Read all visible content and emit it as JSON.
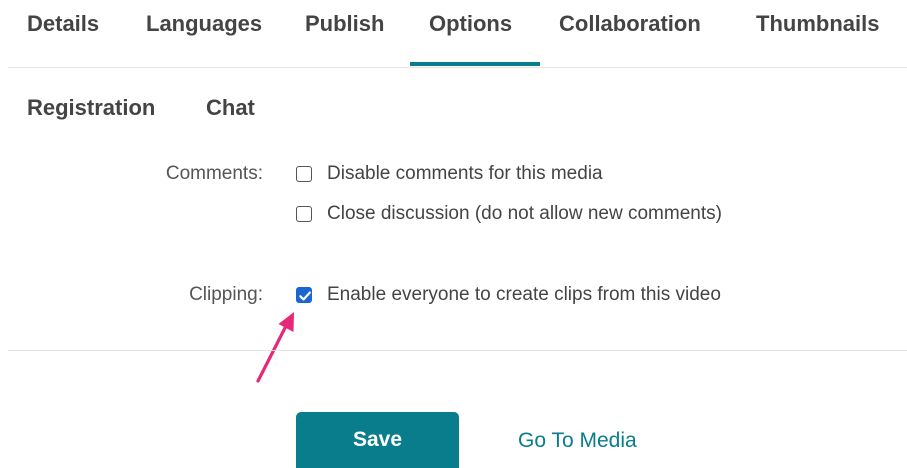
{
  "tabs": {
    "row1": [
      {
        "label": "Details"
      },
      {
        "label": "Languages"
      },
      {
        "label": "Publish"
      },
      {
        "label": "Options"
      },
      {
        "label": "Collaboration"
      },
      {
        "label": "Thumbnails"
      }
    ],
    "row2": [
      {
        "label": "Registration"
      },
      {
        "label": "Chat"
      }
    ],
    "active": "Options"
  },
  "options": {
    "comments": {
      "label": "Comments:",
      "disable": {
        "label": "Disable comments for this media",
        "checked": false
      },
      "close": {
        "label": "Close discussion (do not allow new comments)",
        "checked": false
      }
    },
    "clipping": {
      "label": "Clipping:",
      "enable": {
        "label": "Enable everyone to create clips from this video",
        "checked": true
      }
    }
  },
  "actions": {
    "save_label": "Save",
    "go_to_media_label": "Go To Media"
  },
  "colors": {
    "accent": "#0a7d8c",
    "checkbox_checked": "#1a66d2",
    "annotation_arrow": "#e8277a"
  }
}
